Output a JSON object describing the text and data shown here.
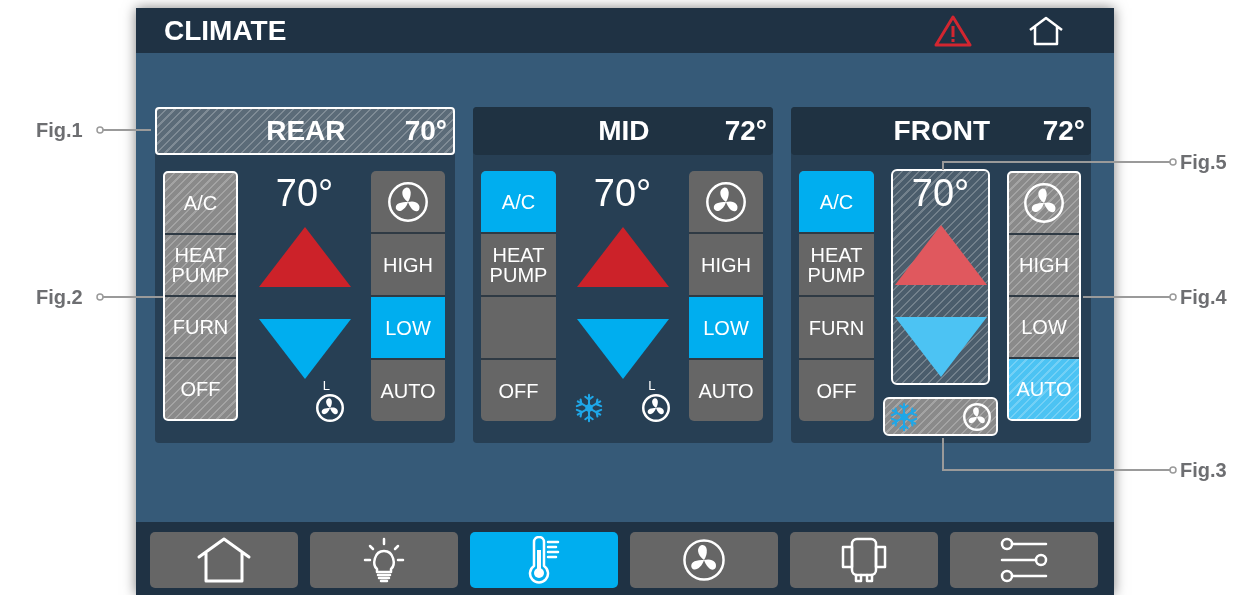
{
  "header": {
    "title": "CLIMATE",
    "alert": true
  },
  "zones": [
    {
      "name": "REAR",
      "temp": "70°",
      "header_highlighted": true,
      "setpoint": "70°",
      "setpoint_highlighted": false,
      "modes_highlighted": true,
      "modes": [
        {
          "kind": "mode",
          "label": "A/C",
          "selected": false
        },
        {
          "kind": "mode",
          "label": "HEAT PUMP",
          "selected": false
        },
        {
          "kind": "mode",
          "label": "FURN",
          "selected": false
        },
        {
          "kind": "mode",
          "label": "OFF",
          "selected": false
        }
      ],
      "fan_highlighted": false,
      "fan_speeds": [
        {
          "label": "HIGH",
          "selected": false
        },
        {
          "label": "LOW",
          "selected": true
        },
        {
          "label": "AUTO",
          "selected": false
        }
      ],
      "indicators": {
        "cooling": false,
        "fan": true,
        "fan_label": "L",
        "highlighted": false
      }
    },
    {
      "name": "MID",
      "temp": "72°",
      "header_highlighted": false,
      "setpoint": "70°",
      "setpoint_highlighted": false,
      "modes_highlighted": false,
      "modes": [
        {
          "kind": "mode",
          "label": "A/C",
          "selected": true
        },
        {
          "kind": "mode",
          "label": "HEAT PUMP",
          "selected": false
        },
        {
          "kind": "blank"
        },
        {
          "kind": "mode",
          "label": "OFF",
          "selected": false
        }
      ],
      "fan_highlighted": false,
      "fan_speeds": [
        {
          "label": "HIGH",
          "selected": false
        },
        {
          "label": "LOW",
          "selected": true
        },
        {
          "label": "AUTO",
          "selected": false
        }
      ],
      "indicators": {
        "cooling": true,
        "fan": true,
        "fan_label": "L",
        "highlighted": false
      }
    },
    {
      "name": "FRONT",
      "temp": "72°",
      "header_highlighted": false,
      "setpoint": "70°",
      "setpoint_highlighted": true,
      "modes_highlighted": false,
      "modes": [
        {
          "kind": "mode",
          "label": "A/C",
          "selected": true
        },
        {
          "kind": "mode",
          "label": "HEAT PUMP",
          "selected": false
        },
        {
          "kind": "mode",
          "label": "FURN",
          "selected": false
        },
        {
          "kind": "mode",
          "label": "OFF",
          "selected": false
        }
      ],
      "fan_highlighted": true,
      "fan_speeds": [
        {
          "label": "HIGH",
          "selected": false
        },
        {
          "label": "LOW",
          "selected": false
        },
        {
          "label": "AUTO",
          "selected": true
        }
      ],
      "indicators": {
        "cooling": true,
        "fan": true,
        "highlighted": true
      }
    }
  ],
  "nav": [
    {
      "kind": "home",
      "selected": false
    },
    {
      "kind": "light",
      "selected": false
    },
    {
      "kind": "climate",
      "selected": true
    },
    {
      "kind": "fan",
      "selected": false
    },
    {
      "kind": "slide",
      "selected": false
    },
    {
      "kind": "settings",
      "selected": false
    }
  ],
  "callouts": [
    {
      "label": "Fig.1"
    },
    {
      "label": "Fig.2"
    },
    {
      "label": "Fig.5"
    },
    {
      "label": "Fig.4"
    },
    {
      "label": "Fig.3"
    }
  ]
}
